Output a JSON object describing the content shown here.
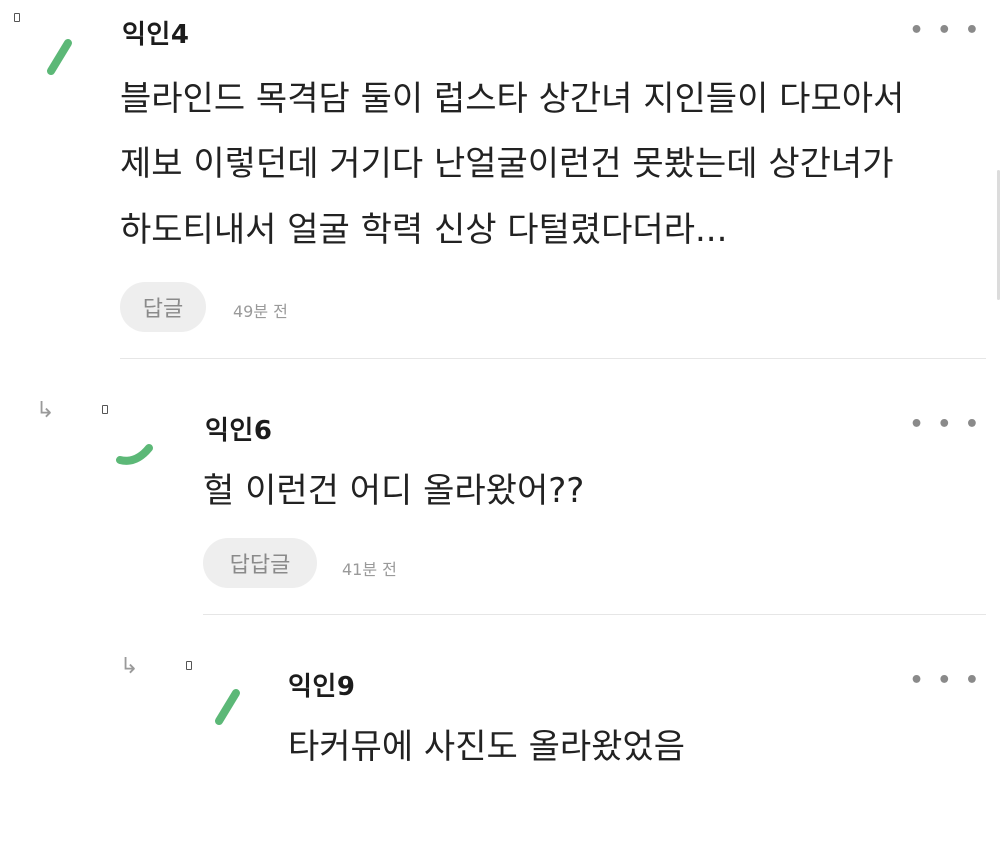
{
  "more_label": "• • •",
  "reply_arrow": "↳",
  "comments": [
    {
      "nickname": "익인4",
      "lines": [
        "블라인드 목격담 둘이 럽스타 상간녀 지인들이 다모아서",
        "제보 이렇던데 거기다 난얼굴이런건 못봤는데 상간녀가",
        "하도티내서 얼굴 학력 신상 다털렸다더라..."
      ],
      "reply_label": "답글",
      "time": "49분 전"
    },
    {
      "nickname": "익인6",
      "lines": [
        "헐 이런건 어디 올라왔어??"
      ],
      "reply_label": "답답글",
      "time": "41분 전"
    },
    {
      "nickname": "익인9",
      "lines": [
        "타커뮤에 사진도 올라왔었음"
      ]
    }
  ],
  "colors": {
    "accent_green": "#5cb877",
    "divider": "#e6e6e6",
    "pill_bg": "#eeeeee"
  }
}
